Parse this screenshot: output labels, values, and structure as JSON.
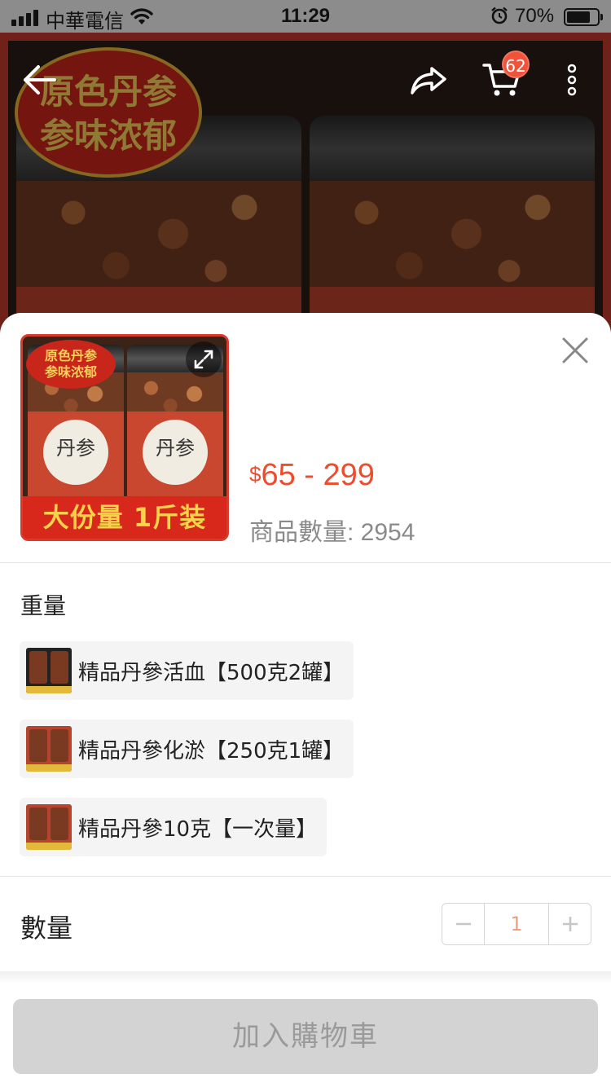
{
  "status_bar": {
    "carrier": "中華電信",
    "time": "11:29",
    "battery_percent": "70%",
    "battery_level": 0.7
  },
  "product_image": {
    "badge_line1": "原色丹参",
    "badge_line2": "参味浓郁"
  },
  "nav": {
    "cart_count": "62"
  },
  "sheet": {
    "thumb": {
      "badge_line1": "原色丹参",
      "badge_line2": "参味浓郁",
      "jar_label": "丹参",
      "banner": "大份量 1斤装"
    },
    "price": {
      "currency": "$",
      "range": "65 - 299"
    },
    "stock_text": "商品數量: 2954",
    "variation_title": "重量",
    "options": [
      {
        "label": "精品丹參活血【500克2罐】"
      },
      {
        "label": "精品丹參化淤【250克1罐】"
      },
      {
        "label": "精品丹參10克【一次量】"
      }
    ],
    "quantity_label": "數量",
    "quantity_value": "1",
    "add_to_cart_label": "加入購物車"
  },
  "colors": {
    "accent": "#ee4d2d",
    "disabled_button": "#d3d3d3"
  }
}
